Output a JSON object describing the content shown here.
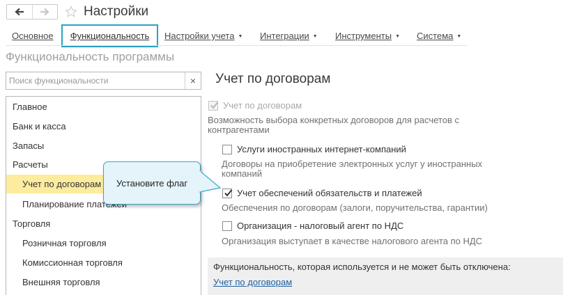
{
  "window": {
    "title": "Настройки"
  },
  "tabs": [
    {
      "label": "Основное",
      "active": false
    },
    {
      "label": "Функциональность",
      "active": true
    },
    {
      "label": "Настройки учета",
      "dropdown": true
    },
    {
      "label": "Интеграции",
      "dropdown": true
    },
    {
      "label": "Инструменты",
      "dropdown": true
    },
    {
      "label": "Система",
      "dropdown": true
    }
  ],
  "page": {
    "subtitle": "Функциональность программы"
  },
  "search": {
    "placeholder": "Поиск функциональности",
    "value": "",
    "clear_glyph": "×"
  },
  "tree": {
    "items": [
      {
        "label": "Главное",
        "level": 0
      },
      {
        "label": "Банк и касса",
        "level": 0
      },
      {
        "label": "Запасы",
        "level": 0
      },
      {
        "label": "Расчеты",
        "level": 0
      },
      {
        "label": "Учет по договорам",
        "level": 1,
        "selected": true
      },
      {
        "label": "Планирование платежей",
        "level": 1
      },
      {
        "label": "Торговля",
        "level": 0
      },
      {
        "label": "Розничная торговля",
        "level": 1
      },
      {
        "label": "Комиссионная торговля",
        "level": 1
      },
      {
        "label": "Внешняя торговля",
        "level": 1
      }
    ]
  },
  "callout": {
    "text": "Установите флаг"
  },
  "section": {
    "title": "Учет по договорам",
    "main_option": {
      "label": "Учет по договорам",
      "checked": true,
      "disabled": true,
      "description_line1": "Возможность выбора конкретных договоров для расчетов с",
      "description_line2": "контрагентами"
    },
    "options": [
      {
        "label": "Услуги иностранных интернет-компаний",
        "checked": false,
        "description_line1": "Договоры на приобретение электронных услуг у иностранных",
        "description_line2": "компаний"
      },
      {
        "label": "Учет обеспечений обязательств и платежей",
        "checked": true,
        "description_line1": "Обеспечения по договорам (залоги, поручительства, гарантии)"
      },
      {
        "label": "Организация - налоговый агент по НДС",
        "checked": false,
        "description_line1": "Организация выступает в качестве налогового агента по НДС"
      }
    ]
  },
  "info": {
    "text": "Функциональность, которая используется и не может быть отключена:",
    "link": "Учет по договорам"
  },
  "colors": {
    "accent": "#2aa2c1",
    "selection": "#fdec9e",
    "callout_bg": "#e5f4fa",
    "link": "#1f5f9e",
    "star": "#d0d0d0"
  }
}
